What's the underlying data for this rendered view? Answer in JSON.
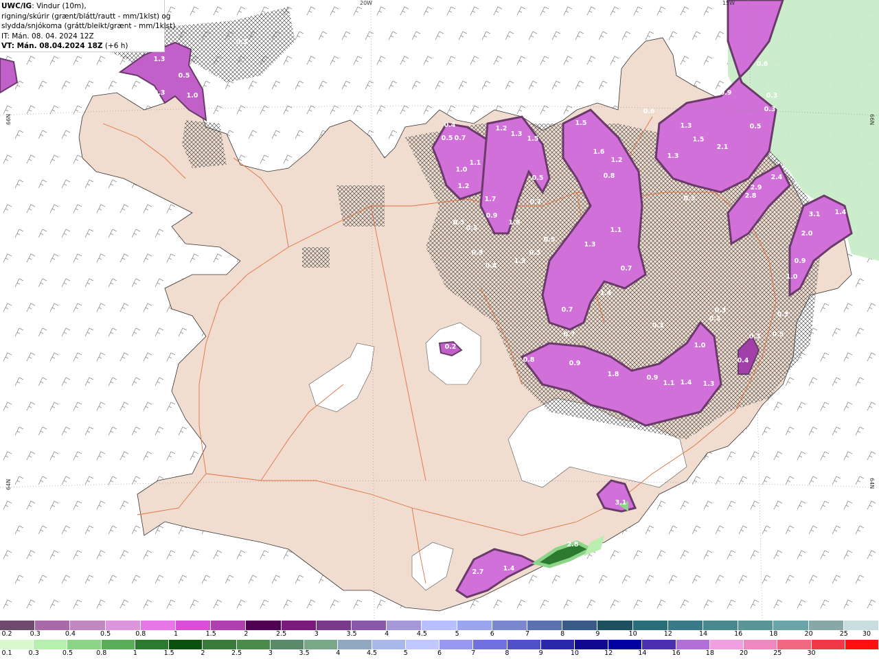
{
  "header": {
    "line1_bold": "UWC/IG",
    "line1_rest": ": Vindur (10m),",
    "line2": "rigning/skúrir (grænt/blátt/rautt - mm/1klst) og",
    "line3": "slydda/snjókoma (grátt/bleikt/grænt - mm/1klst)",
    "line4": "IT: Mán. 08. 04. 2024 12Z",
    "line5_bold": "VT: Mán. 08.04.2024 18Z",
    "line5_rest": " (+6 h)"
  },
  "graticule": {
    "lon_top_left": "20W",
    "lon_top_right": "15W",
    "lat_left_upper": "66N",
    "lat_left_lower": "64N",
    "lat_right_upper": "66N",
    "lat_right_lower": "64N"
  },
  "values": [
    {
      "t": "1.3"
    },
    {
      "t": "0.5"
    },
    {
      "t": "0.3"
    },
    {
      "t": "1.0"
    },
    {
      "t": "0.3"
    },
    {
      "t": "0.4"
    },
    {
      "t": "0.5"
    },
    {
      "t": "0.7"
    },
    {
      "t": "1.2"
    },
    {
      "t": "1.3"
    },
    {
      "t": "1.5"
    },
    {
      "t": "1.5"
    },
    {
      "t": "1.6"
    },
    {
      "t": "1.2"
    },
    {
      "t": "0.8"
    },
    {
      "t": "0.6"
    },
    {
      "t": "1.3"
    },
    {
      "t": "1.5"
    },
    {
      "t": "2.1"
    },
    {
      "t": "1.3"
    },
    {
      "t": "0.9"
    },
    {
      "t": "0.3"
    },
    {
      "t": "0.5"
    },
    {
      "t": "0.6"
    },
    {
      "t": "1.0"
    },
    {
      "t": "1.2"
    },
    {
      "t": "0.5"
    },
    {
      "t": "1.1"
    },
    {
      "t": "1.7"
    },
    {
      "t": "0.9"
    },
    {
      "t": "0.5"
    },
    {
      "t": "0.3"
    },
    {
      "t": "1.6"
    },
    {
      "t": "0.7"
    },
    {
      "t": "0.5"
    },
    {
      "t": "0.5"
    },
    {
      "t": "0.9"
    },
    {
      "t": "0.4"
    },
    {
      "t": "1.3"
    },
    {
      "t": "1.3"
    },
    {
      "t": "1.1"
    },
    {
      "t": "0.7"
    },
    {
      "t": "1.4"
    },
    {
      "t": "0.7"
    },
    {
      "t": "0.7"
    },
    {
      "t": "0.8"
    },
    {
      "t": "0.9"
    },
    {
      "t": "1.8"
    },
    {
      "t": "0.9"
    },
    {
      "t": "1.1"
    },
    {
      "t": "1.4"
    },
    {
      "t": "1.3"
    },
    {
      "t": "1.0"
    },
    {
      "t": "0.3"
    },
    {
      "t": "0.3"
    },
    {
      "t": "2.9"
    },
    {
      "t": "2.4"
    },
    {
      "t": "2.8"
    },
    {
      "t": "3.1"
    },
    {
      "t": "1.4"
    },
    {
      "t": "2.0"
    },
    {
      "t": "0.9"
    },
    {
      "t": "1.0"
    },
    {
      "t": "0.3"
    },
    {
      "t": "0.3"
    },
    {
      "t": "0.4"
    },
    {
      "t": "0.3"
    },
    {
      "t": "0.2"
    },
    {
      "t": "3.1"
    },
    {
      "t": "2.8"
    },
    {
      "t": "2.7"
    },
    {
      "t": "1.4"
    },
    {
      "t": "0.3"
    },
    {
      "t": "0.3"
    },
    {
      "t": "0.5"
    }
  ],
  "legend_snow": {
    "colors": [
      "#6e4a6e",
      "#a86aa8",
      "#c088c0",
      "#dc96dc",
      "#e878e8",
      "#d850d8",
      "#b040b0",
      "#500050",
      "#7a1a7a",
      "#7a3a8a",
      "#8a58a8",
      "#a498d8",
      "#b8c0ff",
      "#9aa6ee",
      "#7a88d0",
      "#5a72b0",
      "#3a5a88",
      "#1e5060",
      "#2a6e7a",
      "#3a7a88",
      "#4a8890",
      "#5a9698",
      "#6aa4a8",
      "#88a8a8",
      "#c8dede"
    ],
    "labels": [
      "0.2",
      "0.3",
      "0.4",
      "0.5",
      "0.8",
      "1",
      "1.5",
      "2",
      "2.5",
      "3",
      "3.5",
      "4",
      "4.5",
      "5",
      "6",
      "7",
      "8",
      "9",
      "10",
      "12",
      "14",
      "16",
      "18",
      "20",
      "25",
      "30"
    ]
  },
  "legend_rain": {
    "colors": [
      "#d8f8d0",
      "#b8eeb0",
      "#8cd488",
      "#5aae5a",
      "#2c7a30",
      "#0c5010",
      "#3a7a3a",
      "#4a8a4a",
      "#5a8a6a",
      "#78a888",
      "#90a8c0",
      "#a8b8e8",
      "#c0c8ff",
      "#9898f0",
      "#7070e0",
      "#5050c8",
      "#2828a8",
      "#100890",
      "#0000a0",
      "#4a30b0",
      "#b070d8",
      "#f0a0e0",
      "#f088c0",
      "#f06880",
      "#f03848",
      "#ff1010"
    ],
    "labels": [
      "0.1",
      "0.3",
      "0.5",
      "0.8",
      "1",
      "1.5",
      "2",
      "2.5",
      "3",
      "3.5",
      "4",
      "4.5",
      "5",
      "6",
      "7",
      "8",
      "9",
      "10",
      "12",
      "14",
      "16",
      "18",
      "20",
      "25",
      "30"
    ]
  }
}
